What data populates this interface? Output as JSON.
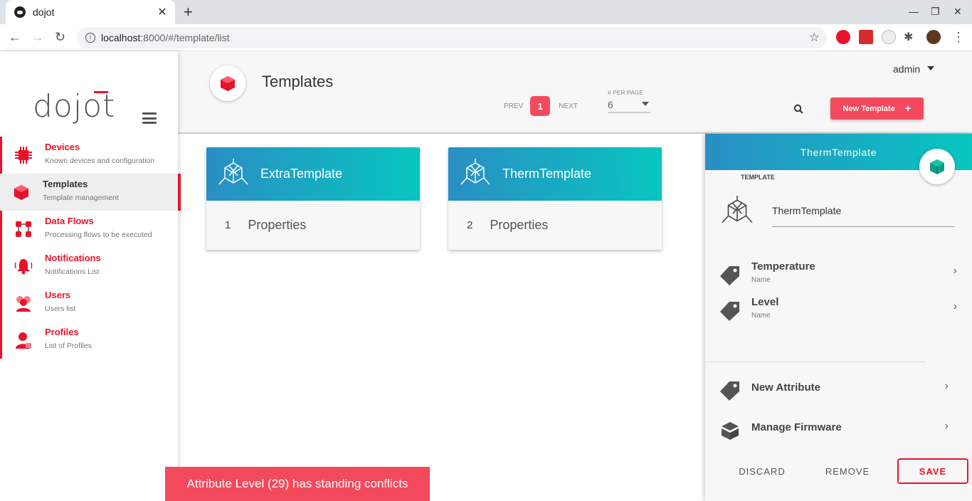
{
  "browser": {
    "tab_title": "dojot",
    "url_host": "localhost",
    "url_path": ":8000/#/template/list"
  },
  "sidebar": {
    "logo": "dojot",
    "items": [
      {
        "label": "Devices",
        "sub": "Known devices and configuration",
        "icon": "devices-icon"
      },
      {
        "label": "Templates",
        "sub": "Template management",
        "icon": "templates-icon"
      },
      {
        "label": "Data Flows",
        "sub": "Processing flows to be executed",
        "icon": "flows-icon"
      },
      {
        "label": "Notifications",
        "sub": "Notifications List",
        "icon": "bell-icon"
      },
      {
        "label": "Users",
        "sub": "Users list",
        "icon": "users-icon"
      },
      {
        "label": "Profiles",
        "sub": "List of Profiles",
        "icon": "profile-icon"
      }
    ]
  },
  "header": {
    "title": "Templates",
    "prev": "PREV",
    "page": "1",
    "next": "NEXT",
    "per_page_label": "# PER PAGE",
    "per_page_value": "6",
    "user": "admin",
    "new_button": "New Template",
    "new_button_icon": "+"
  },
  "cards": [
    {
      "name": "ExtraTemplate",
      "count": "1",
      "props": "Properties"
    },
    {
      "name": "ThermTemplate",
      "count": "2",
      "props": "Properties"
    }
  ],
  "panel": {
    "title": "ThermTemplate",
    "section_label": "TEMPLATE",
    "name_value": "ThermTemplate",
    "attributes": [
      {
        "name": "Temperature",
        "sub": "Name"
      },
      {
        "name": "Level",
        "sub": "Name"
      }
    ],
    "new_attribute": "New Attribute",
    "manage_firmware": "Manage Firmware",
    "discard": "DISCARD",
    "remove": "REMOVE",
    "save": "SAVE"
  },
  "toast": "Attribute Level (29) has standing conflicts",
  "colors": {
    "accent": "#e8132b",
    "button": "#f24a5c",
    "gradient_start": "#2a8ec4",
    "gradient_end": "#07c6c0"
  }
}
